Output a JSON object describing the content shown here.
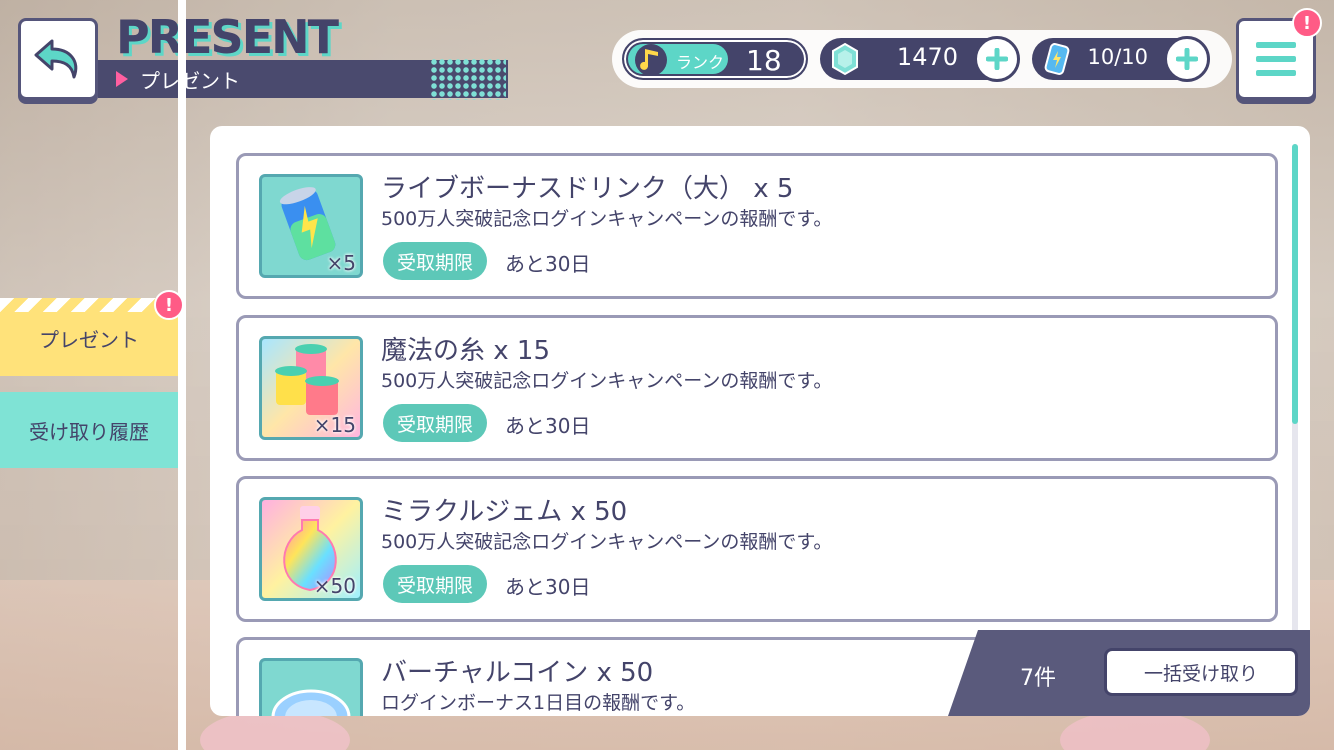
{
  "header": {
    "title": "PRESENT",
    "subtitle": "プレゼント"
  },
  "status": {
    "rank_label": "ランク",
    "rank_value": "18",
    "gems": "1470",
    "stamina": "10/10",
    "menu_badge": "!"
  },
  "sidebar": {
    "items": [
      {
        "label": "プレゼント",
        "badge": "!",
        "active": true
      },
      {
        "label": "受け取り履歴",
        "active": false
      }
    ]
  },
  "presents": [
    {
      "name": "ライブボーナスドリンク（大） x 5",
      "desc": "500万人突破記念ログインキャンペーンの報酬です。",
      "deadline_label": "受取期限",
      "remaining": "あと30日",
      "qty": "×5",
      "icon": "drink-can-icon"
    },
    {
      "name": "魔法の糸 x 15",
      "desc": "500万人突破記念ログインキャンペーンの報酬です。",
      "deadline_label": "受取期限",
      "remaining": "あと30日",
      "qty": "×15",
      "icon": "thread-spools-icon"
    },
    {
      "name": "ミラクルジェム x 50",
      "desc": "500万人突破記念ログインキャンペーンの報酬です。",
      "deadline_label": "受取期限",
      "remaining": "あと30日",
      "qty": "×50",
      "icon": "gem-bottle-icon"
    },
    {
      "name": "バーチャルコイン x 50",
      "desc": "ログインボーナス1日目の報酬です。",
      "icon": "virtual-coin-icon"
    }
  ],
  "footer": {
    "count": "7件",
    "claim_all": "一括受け取り"
  },
  "colors": {
    "accent_teal": "#5dd6c7",
    "navy": "#44446a",
    "badge_pink": "#ff5b86",
    "active_tab": "#ffe27a"
  }
}
